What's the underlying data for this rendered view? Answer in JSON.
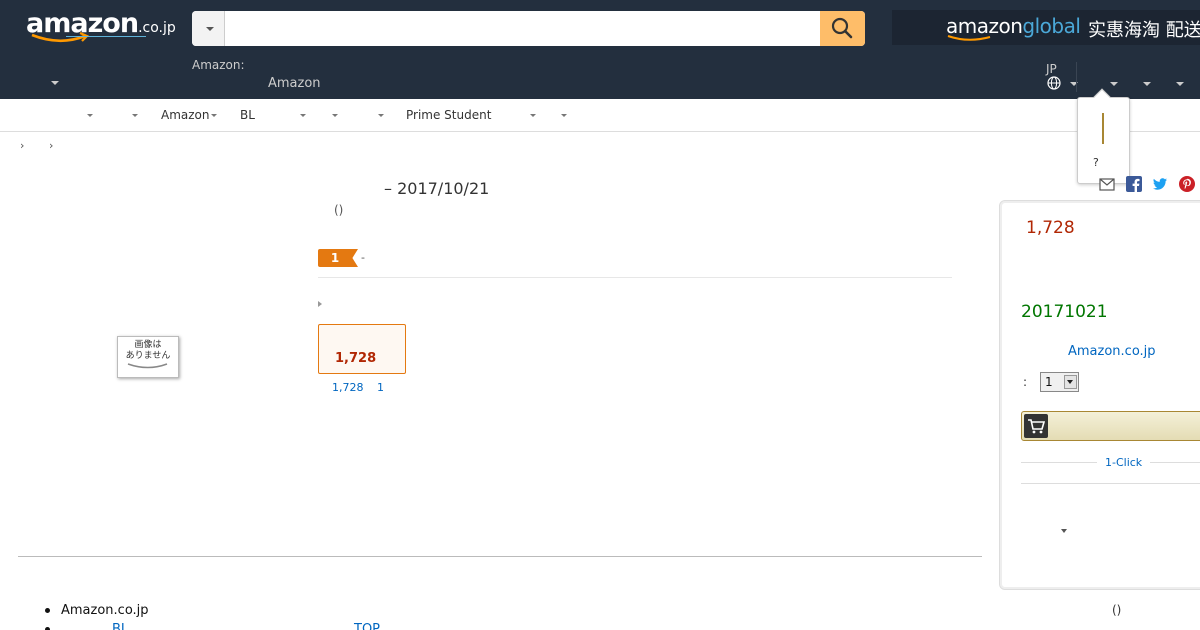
{
  "header": {
    "logo_text": "amazon",
    "logo_suffix": ".co.jp",
    "search": {
      "value": "",
      "placeholder": ""
    },
    "global": {
      "logo_part1": "amazon",
      "logo_part2": "global",
      "promo_text": "实惠海淘 配送"
    },
    "delivery_label": "Amazon:",
    "delivery_sub": "Amazon",
    "language": "JP"
  },
  "subnav": {
    "items": [
      "Amazon",
      "BL",
      "Prime Student"
    ]
  },
  "popover": {
    "question": "?"
  },
  "breadcrumb": {
    "sep1": "›",
    "sep2": "›"
  },
  "product": {
    "title": "– 2017/10/21",
    "byline": "()",
    "rank_badge": "1",
    "rank_dash": "-",
    "no_image_text": "画像は\nありません",
    "format_price": "1,728",
    "format_link_price": "1,728",
    "format_link_count": "1"
  },
  "buybox": {
    "price": "1,728",
    "delivery_date": "20171021",
    "seller": "Amazon.co.jp",
    "qty_label": ":",
    "qty_value": "1",
    "one_click": "1-Click"
  },
  "footer": {
    "item1": "Amazon.co.jp",
    "row2_link1": "BL",
    "row2_link2": "TOP",
    "paren": "()"
  },
  "colors": {
    "nav_bg": "#232f3e",
    "search_button": "#febd69",
    "price": "#b12704",
    "link": "#0066c0",
    "delivery_green": "#007600",
    "badge_orange": "#e47911"
  },
  "icons": [
    "search-icon",
    "globe-icon",
    "facebook-icon",
    "twitter-icon",
    "pinterest-icon",
    "email-icon",
    "cart-icon"
  ]
}
